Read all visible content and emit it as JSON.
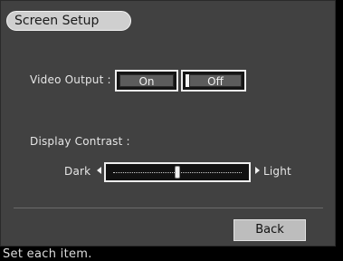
{
  "title": "Screen Setup",
  "video_output": {
    "label": "Video Output :",
    "options": [
      "On",
      "Off"
    ],
    "selected": "Off"
  },
  "display_contrast": {
    "label": "Display Contrast :",
    "min_label": "Dark",
    "max_label": "Light",
    "level": 0.5
  },
  "buttons": {
    "back": "Back"
  },
  "status_text": "Set each item.",
  "colors": {
    "panel": "#414141",
    "frame": "#000000",
    "accent": "#ededed"
  }
}
